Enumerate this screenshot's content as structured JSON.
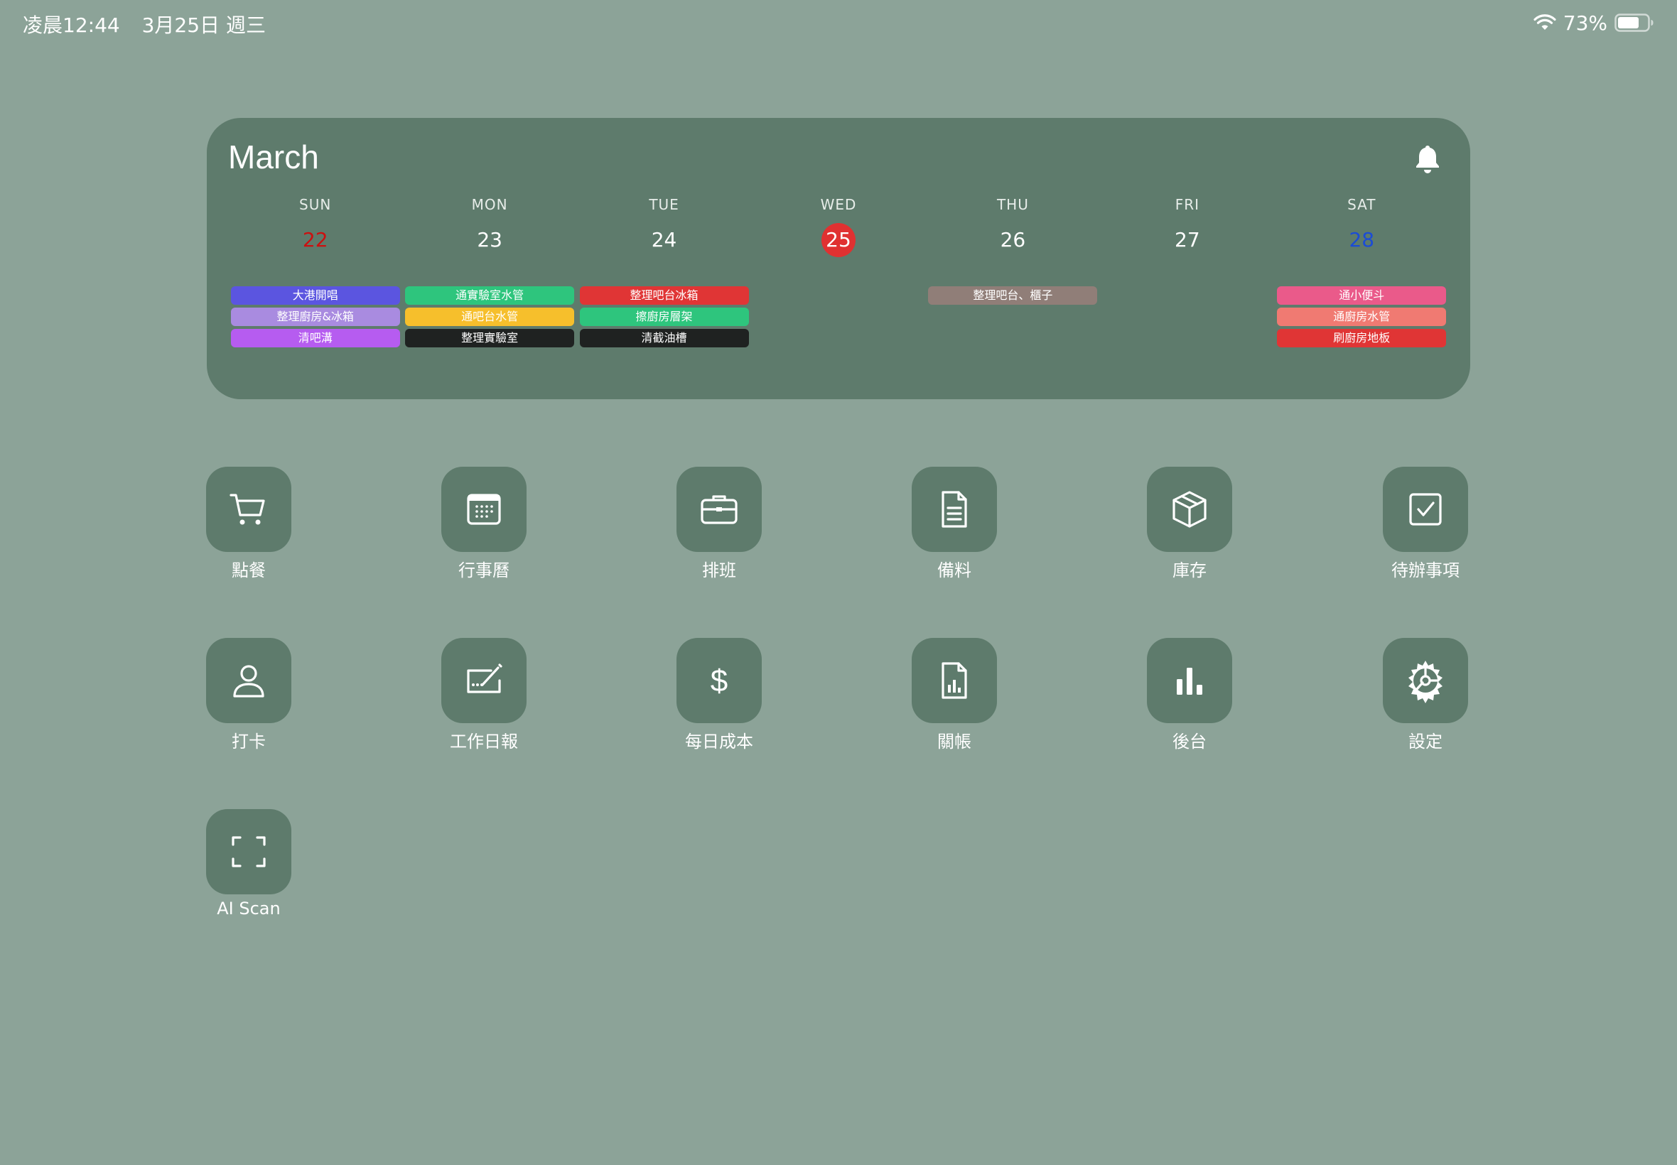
{
  "status_bar": {
    "time": "凌晨12:44",
    "date": "3月25日 週三",
    "battery_percent_text": "73%",
    "battery_level": 0.73,
    "wifi_icon": "wifi-icon",
    "battery_icon": "battery-icon"
  },
  "calendar": {
    "month": "March",
    "bell_icon": "bell-icon",
    "days": [
      {
        "dow": "SUN",
        "num": "22",
        "style": "sun",
        "events": [
          {
            "label": "大港開唱",
            "color": "#5b55e0"
          },
          {
            "label": "整理廚房&冰箱",
            "color": "#a98be0"
          },
          {
            "label": "清吧溝",
            "color": "#b65cf0"
          }
        ]
      },
      {
        "dow": "MON",
        "num": "23",
        "style": "normal",
        "events": [
          {
            "label": "通實驗室水管",
            "color": "#2ec57d"
          },
          {
            "label": "通吧台水管",
            "color": "#f6bf2c"
          },
          {
            "label": "整理實驗室",
            "color": "#1f2221"
          }
        ]
      },
      {
        "dow": "TUE",
        "num": "24",
        "style": "normal",
        "events": [
          {
            "label": "整理吧台冰箱",
            "color": "#e03535"
          },
          {
            "label": "擦廚房層架",
            "color": "#2ec57d"
          },
          {
            "label": "清截油槽",
            "color": "#1f2221"
          }
        ]
      },
      {
        "dow": "WED",
        "num": "25",
        "style": "today",
        "events": []
      },
      {
        "dow": "THU",
        "num": "26",
        "style": "normal",
        "events": [
          {
            "label": "整理吧台、櫃子",
            "color": "#907e78"
          }
        ]
      },
      {
        "dow": "FRI",
        "num": "27",
        "style": "normal",
        "events": []
      },
      {
        "dow": "SAT",
        "num": "28",
        "style": "sat",
        "events": [
          {
            "label": "通小便斗",
            "color": "#ea5a8a"
          },
          {
            "label": "通廚房水管",
            "color": "#f07a72"
          },
          {
            "label": "刷廚房地板",
            "color": "#e03535"
          }
        ]
      }
    ]
  },
  "apps": [
    {
      "name": "order",
      "label": "點餐",
      "icon": "cart-icon"
    },
    {
      "name": "calendar",
      "label": "行事曆",
      "icon": "calendar-icon"
    },
    {
      "name": "schedule",
      "label": "排班",
      "icon": "briefcase-icon"
    },
    {
      "name": "prep",
      "label": "備料",
      "icon": "document-icon"
    },
    {
      "name": "inventory",
      "label": "庫存",
      "icon": "box-icon"
    },
    {
      "name": "todo",
      "label": "待辦事項",
      "icon": "checkbox-icon"
    },
    {
      "name": "clock-in",
      "label": "打卡",
      "icon": "person-icon"
    },
    {
      "name": "daily-report",
      "label": "工作日報",
      "icon": "signature-icon"
    },
    {
      "name": "daily-cost",
      "label": "每日成本",
      "icon": "dollar-icon"
    },
    {
      "name": "closing",
      "label": "關帳",
      "icon": "report-icon"
    },
    {
      "name": "backend",
      "label": "後台",
      "icon": "bar-chart-icon"
    },
    {
      "name": "settings",
      "label": "設定",
      "icon": "gear-icon"
    },
    {
      "name": "ai-scan",
      "label": "AI Scan",
      "icon": "scan-icon"
    }
  ]
}
